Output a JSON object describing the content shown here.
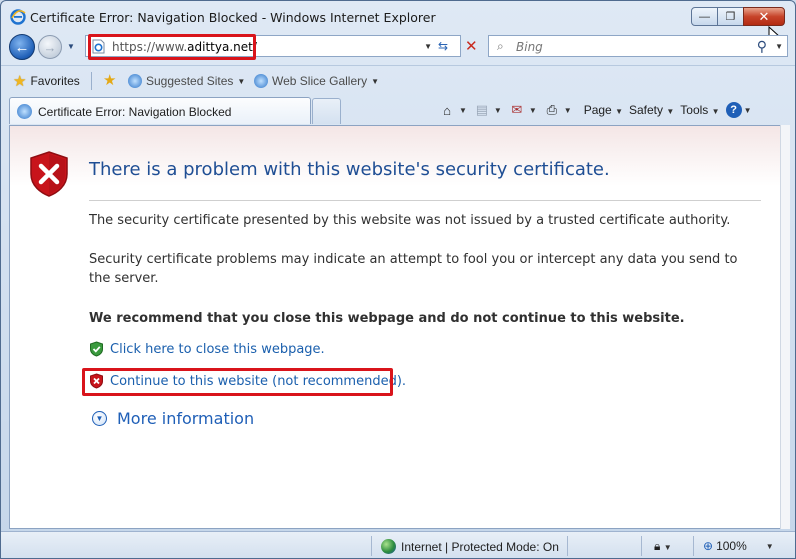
{
  "window": {
    "title": "Certificate Error: Navigation Blocked - Windows Internet Explorer",
    "controls": {
      "minimize": "—",
      "restore": "❐",
      "close": "✕"
    }
  },
  "address_bar": {
    "url_prefix": "https://www.",
    "url_host": "adittya.net/",
    "search_placeholder": "Bing"
  },
  "favorites_bar": {
    "favorites_label": "Favorites",
    "items": [
      {
        "label": "Suggested Sites"
      },
      {
        "label": "Web Slice Gallery"
      }
    ]
  },
  "tab": {
    "title": "Certificate Error: Navigation Blocked"
  },
  "command_bar": {
    "page_label": "Page",
    "safety_label": "Safety",
    "tools_label": "Tools",
    "help_label": "?"
  },
  "page": {
    "heading": "There is a problem with this website's security certificate.",
    "para1": "The security certificate presented by this website was not issued by a trusted certificate authority.",
    "para2": "Security certificate problems may indicate an attempt to fool you or intercept any data you send to the server.",
    "recommendation": "We recommend that you close this webpage and do not continue to this website.",
    "close_link": "Click here to close this webpage.",
    "continue_link": "Continue to this website (not recommended).",
    "more_info": "More information"
  },
  "status_bar": {
    "zone": "Internet | Protected Mode: On",
    "zoom": "100%"
  },
  "colors": {
    "link": "#1a5fad",
    "heading": "#1f4e94",
    "highlight": "#d9141b"
  },
  "icons": [
    "ie-icon",
    "back-icon",
    "forward-icon",
    "refresh-icon",
    "stop-icon",
    "search-icon",
    "star-icon",
    "home-icon",
    "rss-icon",
    "mail-icon",
    "print-icon",
    "help-icon",
    "shield-error-icon",
    "shield-ok-icon",
    "globe-icon",
    "zoom-icon"
  ]
}
